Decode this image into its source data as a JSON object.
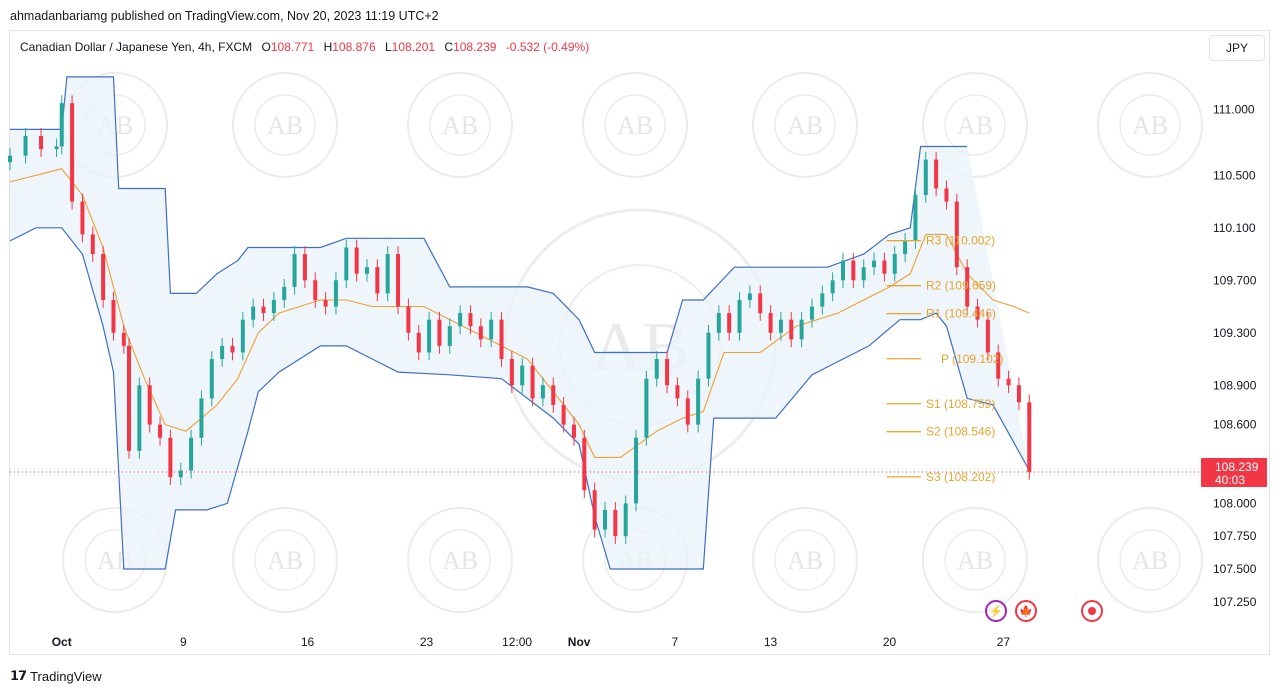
{
  "publisher": "ahmadanbariamg published on TradingView.com, Nov 20, 2023 11:19 UTC+2",
  "legend": {
    "symbol": "Canadian Dollar / Japanese Yen, 4h, FXCM",
    "open_label": "O",
    "open": "108.771",
    "high_label": "H",
    "high": "108.876",
    "low_label": "L",
    "low": "108.201",
    "close_label": "C",
    "close": "108.239",
    "change": "-0.532 (-0.49%)"
  },
  "currency_button": "JPY",
  "price_tag": {
    "price": "108.239",
    "countdown": "40:03"
  },
  "brand": "TradingView",
  "watermark_text": "AB",
  "colors": {
    "up": "#26a69a",
    "down": "#f23645",
    "band": "#3f6fc4",
    "basis": "#f0a030",
    "pivot": "#e8a530",
    "fill": "#e8f1fa",
    "price": "#f23645"
  },
  "chart_data": {
    "type": "line",
    "title": "Canadian Dollar / Japanese Yen, 4h, FXCM",
    "ylim": [
      107.05,
      111.6
    ],
    "y_ticks": [
      "111.000",
      "110.500",
      "110.100",
      "109.700",
      "109.300",
      "108.900",
      "108.600",
      "108.200",
      "108.000",
      "107.750",
      "107.500",
      "107.250"
    ],
    "x_ticks": [
      "Oct",
      "9",
      "16",
      "23",
      "12:00",
      "Nov",
      "7",
      "13",
      "20",
      "27"
    ],
    "x_tick_pos": [
      0.0,
      0.235,
      0.475,
      0.705,
      0.88,
      1.0,
      1.185,
      1.37,
      1.6,
      1.82
    ],
    "x_range": [
      -0.1,
      2.2
    ],
    "pivots": [
      {
        "label": "R3 (110.002)",
        "value": 110.002
      },
      {
        "label": "R2 (109.659)",
        "value": 109.659
      },
      {
        "label": "R1 (109.446)",
        "value": 109.446
      },
      {
        "label": "P (109.102)",
        "value": 109.102
      },
      {
        "label": "S1 (108.759)",
        "value": 108.759
      },
      {
        "label": "S2 (108.546)",
        "value": 108.546
      },
      {
        "label": "S3 (108.202)",
        "value": 108.202
      }
    ],
    "pivot_x_range": [
      1.6,
      1.68
    ],
    "last_price": 108.239,
    "closes": [
      [
        -0.1,
        110.65
      ],
      [
        -0.07,
        110.8
      ],
      [
        -0.04,
        110.7
      ],
      [
        -0.01,
        110.72
      ],
      [
        0.0,
        111.05
      ],
      [
        0.02,
        110.3
      ],
      [
        0.04,
        110.05
      ],
      [
        0.06,
        109.9
      ],
      [
        0.08,
        109.55
      ],
      [
        0.1,
        109.3
      ],
      [
        0.12,
        109.2
      ],
      [
        0.13,
        108.4
      ],
      [
        0.15,
        108.9
      ],
      [
        0.17,
        108.6
      ],
      [
        0.19,
        108.5
      ],
      [
        0.21,
        108.2
      ],
      [
        0.23,
        108.25
      ],
      [
        0.25,
        108.5
      ],
      [
        0.27,
        108.8
      ],
      [
        0.29,
        109.1
      ],
      [
        0.31,
        109.2
      ],
      [
        0.33,
        109.15
      ],
      [
        0.35,
        109.4
      ],
      [
        0.37,
        109.5
      ],
      [
        0.39,
        109.45
      ],
      [
        0.41,
        109.55
      ],
      [
        0.43,
        109.65
      ],
      [
        0.45,
        109.9
      ],
      [
        0.47,
        109.7
      ],
      [
        0.49,
        109.55
      ],
      [
        0.51,
        109.5
      ],
      [
        0.53,
        109.7
      ],
      [
        0.55,
        109.95
      ],
      [
        0.57,
        109.75
      ],
      [
        0.59,
        109.8
      ],
      [
        0.61,
        109.6
      ],
      [
        0.63,
        109.9
      ],
      [
        0.65,
        109.5
      ],
      [
        0.67,
        109.3
      ],
      [
        0.69,
        109.15
      ],
      [
        0.71,
        109.4
      ],
      [
        0.73,
        109.2
      ],
      [
        0.75,
        109.35
      ],
      [
        0.77,
        109.45
      ],
      [
        0.79,
        109.35
      ],
      [
        0.81,
        109.25
      ],
      [
        0.83,
        109.4
      ],
      [
        0.85,
        109.1
      ],
      [
        0.87,
        108.9
      ],
      [
        0.89,
        109.05
      ],
      [
        0.91,
        108.8
      ],
      [
        0.93,
        108.9
      ],
      [
        0.95,
        108.75
      ],
      [
        0.97,
        108.6
      ],
      [
        0.99,
        108.5
      ],
      [
        1.01,
        108.1
      ],
      [
        1.03,
        107.8
      ],
      [
        1.05,
        107.95
      ],
      [
        1.07,
        107.75
      ],
      [
        1.09,
        108.0
      ],
      [
        1.11,
        108.5
      ],
      [
        1.13,
        108.95
      ],
      [
        1.15,
        109.1
      ],
      [
        1.17,
        108.9
      ],
      [
        1.19,
        108.8
      ],
      [
        1.21,
        108.6
      ],
      [
        1.23,
        108.95
      ],
      [
        1.25,
        109.3
      ],
      [
        1.27,
        109.45
      ],
      [
        1.29,
        109.3
      ],
      [
        1.31,
        109.55
      ],
      [
        1.33,
        109.6
      ],
      [
        1.35,
        109.45
      ],
      [
        1.37,
        109.3
      ],
      [
        1.39,
        109.4
      ],
      [
        1.41,
        109.25
      ],
      [
        1.43,
        109.4
      ],
      [
        1.45,
        109.5
      ],
      [
        1.47,
        109.6
      ],
      [
        1.49,
        109.7
      ],
      [
        1.51,
        109.85
      ],
      [
        1.53,
        109.7
      ],
      [
        1.55,
        109.8
      ],
      [
        1.57,
        109.85
      ],
      [
        1.59,
        109.75
      ],
      [
        1.61,
        109.9
      ],
      [
        1.63,
        110.0
      ],
      [
        1.65,
        110.35
      ],
      [
        1.67,
        110.62
      ],
      [
        1.69,
        110.4
      ],
      [
        1.71,
        110.3
      ],
      [
        1.73,
        109.8
      ],
      [
        1.75,
        109.5
      ],
      [
        1.77,
        109.4
      ],
      [
        1.79,
        109.15
      ],
      [
        1.81,
        108.95
      ],
      [
        1.83,
        108.9
      ],
      [
        1.85,
        108.77
      ],
      [
        1.87,
        108.24
      ]
    ],
    "upper_band": [
      [
        -0.1,
        110.85
      ],
      [
        0.0,
        110.85
      ],
      [
        0.01,
        111.25
      ],
      [
        0.1,
        111.25
      ],
      [
        0.11,
        110.4
      ],
      [
        0.2,
        110.4
      ],
      [
        0.21,
        109.6
      ],
      [
        0.26,
        109.6
      ],
      [
        0.3,
        109.75
      ],
      [
        0.34,
        109.85
      ],
      [
        0.36,
        109.95
      ],
      [
        0.5,
        109.95
      ],
      [
        0.55,
        110.02
      ],
      [
        0.7,
        110.02
      ],
      [
        0.75,
        109.65
      ],
      [
        0.9,
        109.65
      ],
      [
        0.95,
        109.6
      ],
      [
        1.0,
        109.4
      ],
      [
        1.03,
        109.15
      ],
      [
        1.13,
        109.15
      ],
      [
        1.17,
        109.15
      ],
      [
        1.2,
        109.55
      ],
      [
        1.24,
        109.55
      ],
      [
        1.3,
        109.8
      ],
      [
        1.48,
        109.8
      ],
      [
        1.55,
        109.9
      ],
      [
        1.6,
        110.05
      ],
      [
        1.64,
        110.1
      ],
      [
        1.66,
        110.72
      ],
      [
        1.71,
        110.72
      ],
      [
        1.75,
        110.72
      ]
    ],
    "lower_band": [
      [
        -0.1,
        110.0
      ],
      [
        -0.05,
        110.1
      ],
      [
        0.0,
        110.1
      ],
      [
        0.04,
        109.9
      ],
      [
        0.08,
        109.35
      ],
      [
        0.1,
        109.0
      ],
      [
        0.12,
        107.5
      ],
      [
        0.2,
        107.5
      ],
      [
        0.22,
        107.95
      ],
      [
        0.28,
        107.95
      ],
      [
        0.32,
        108.0
      ],
      [
        0.36,
        108.55
      ],
      [
        0.38,
        108.85
      ],
      [
        0.42,
        109.0
      ],
      [
        0.46,
        109.1
      ],
      [
        0.5,
        109.2
      ],
      [
        0.55,
        109.2
      ],
      [
        0.65,
        109.0
      ],
      [
        0.75,
        108.98
      ],
      [
        0.85,
        108.95
      ],
      [
        0.95,
        108.65
      ],
      [
        1.0,
        108.45
      ],
      [
        1.03,
        107.9
      ],
      [
        1.06,
        107.5
      ],
      [
        1.13,
        107.5
      ],
      [
        1.2,
        107.5
      ],
      [
        1.24,
        107.5
      ],
      [
        1.26,
        108.65
      ],
      [
        1.3,
        108.65
      ],
      [
        1.38,
        108.65
      ],
      [
        1.45,
        108.98
      ],
      [
        1.5,
        109.08
      ],
      [
        1.56,
        109.2
      ],
      [
        1.62,
        109.4
      ],
      [
        1.66,
        109.4
      ],
      [
        1.69,
        109.45
      ],
      [
        1.71,
        109.35
      ],
      [
        1.75,
        108.8
      ],
      [
        1.8,
        108.75
      ],
      [
        1.87,
        108.25
      ]
    ],
    "basis": [
      [
        -0.1,
        110.45
      ],
      [
        0.0,
        110.55
      ],
      [
        0.04,
        110.35
      ],
      [
        0.08,
        109.95
      ],
      [
        0.12,
        109.35
      ],
      [
        0.16,
        108.95
      ],
      [
        0.2,
        108.6
      ],
      [
        0.24,
        108.55
      ],
      [
        0.3,
        108.75
      ],
      [
        0.34,
        108.95
      ],
      [
        0.38,
        109.3
      ],
      [
        0.42,
        109.45
      ],
      [
        0.46,
        109.5
      ],
      [
        0.5,
        109.55
      ],
      [
        0.55,
        109.55
      ],
      [
        0.6,
        109.5
      ],
      [
        0.7,
        109.5
      ],
      [
        0.8,
        109.3
      ],
      [
        0.9,
        109.1
      ],
      [
        0.95,
        108.85
      ],
      [
        1.0,
        108.6
      ],
      [
        1.03,
        108.35
      ],
      [
        1.08,
        108.35
      ],
      [
        1.15,
        108.55
      ],
      [
        1.2,
        108.65
      ],
      [
        1.24,
        108.7
      ],
      [
        1.28,
        109.15
      ],
      [
        1.35,
        109.15
      ],
      [
        1.42,
        109.35
      ],
      [
        1.5,
        109.45
      ],
      [
        1.55,
        109.55
      ],
      [
        1.6,
        109.65
      ],
      [
        1.64,
        109.75
      ],
      [
        1.67,
        110.05
      ],
      [
        1.71,
        110.05
      ],
      [
        1.75,
        109.75
      ],
      [
        1.8,
        109.55
      ],
      [
        1.84,
        109.5
      ],
      [
        1.87,
        109.45
      ]
    ]
  }
}
